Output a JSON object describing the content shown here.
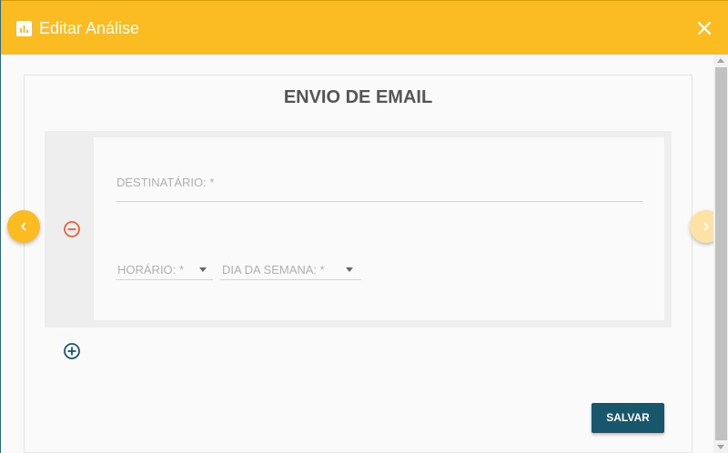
{
  "header": {
    "title": "Editar Análise",
    "icon": "bar-chart-icon",
    "close_icon": "close-icon",
    "background_color": "#fbbc22"
  },
  "form": {
    "title": "ENVIO DE EMAIL",
    "recipient_label": "DESTINATÁRIO: *",
    "time_label": "HORÁRIO: *",
    "weekday_label": "DIA DA SEMANA: *",
    "remove_icon": "minus-circle-icon",
    "add_icon": "plus-circle-icon",
    "remove_color": "#e9603a",
    "add_color": "#17566b"
  },
  "navigation": {
    "prev_icon": "chevron-left-icon",
    "next_icon": "chevron-right-icon"
  },
  "actions": {
    "save_label": "SALVAR",
    "save_color": "#17566b"
  }
}
